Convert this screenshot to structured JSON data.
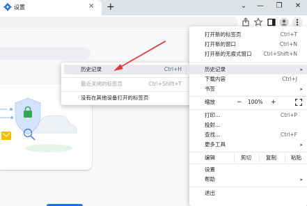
{
  "browser": {
    "tab_title": "设置",
    "new_tab_symbol": "+",
    "close_symbol": "✕",
    "window": {
      "minimize": "—",
      "restore": "❐",
      "close": "✕"
    },
    "collapse_symbol": "⌄"
  },
  "toolbar": {
    "icons": [
      "share-icon",
      "bookmark-star-icon",
      "side-panel-icon",
      "profile-icon",
      "more-menu-icon"
    ]
  },
  "colors": {
    "accent": "#1a73e8",
    "menu_highlight": "#e8eaed",
    "arrow": "#e53935"
  },
  "main_menu": {
    "new_tab": {
      "label": "打开新的标签页",
      "shortcut": "Ctrl+T"
    },
    "new_window": {
      "label": "打开新的窗口",
      "shortcut": "Ctrl+N"
    },
    "new_incognito": {
      "label": "打开新的无痕式窗口",
      "shortcut": "Ctrl+Shift+N"
    },
    "history": {
      "label": "历史记录"
    },
    "downloads": {
      "label": "下载内容",
      "shortcut": "Ctrl+J"
    },
    "bookmarks": {
      "label": "书签"
    },
    "zoom": {
      "label": "缩放",
      "minus": "−",
      "value": "100%",
      "plus": "+"
    },
    "print": {
      "label": "打印...",
      "shortcut": "Ctrl+P"
    },
    "cast": {
      "label": "投射..."
    },
    "find": {
      "label": "查找...",
      "shortcut": "Ctrl+F"
    },
    "more_tools": {
      "label": "更多工具"
    },
    "edit": {
      "label": "编辑",
      "cut": "剪切",
      "copy": "复制",
      "paste": "粘贴"
    },
    "settings": {
      "label": "设置"
    },
    "help": {
      "label": "帮助"
    },
    "exit": {
      "label": "退出"
    }
  },
  "history_submenu": {
    "history": {
      "label": "历史记录",
      "shortcut": "Ctrl+H"
    },
    "recently_closed": {
      "label": "最近关闭的标签页",
      "shortcut": "Ctrl+Shift+T"
    },
    "other_devices": {
      "label": "没有在其他设备打开的标签页"
    }
  }
}
